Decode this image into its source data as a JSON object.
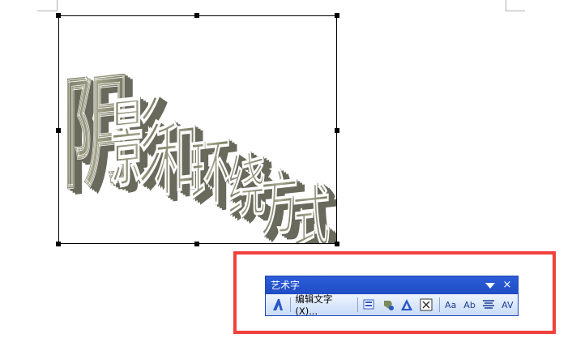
{
  "wordart": {
    "text": "阴影和环绕方式",
    "fill_color": "#8e8f78",
    "shadow_color": "#4f5040"
  },
  "toolbar": {
    "title": "艺术字",
    "edit_text_label": "编辑文字(X)...",
    "close_glyph": "×",
    "buttons": [
      {
        "name": "insert-wordart-icon"
      },
      {
        "name": "wordart-gallery-icon"
      },
      {
        "name": "format-wordart-icon"
      },
      {
        "name": "wordart-shape-icon"
      },
      {
        "name": "text-wrapping-icon"
      },
      {
        "name": "same-letter-heights-icon"
      },
      {
        "name": "vertical-text-icon"
      },
      {
        "name": "alignment-icon"
      },
      {
        "name": "character-spacing-icon"
      }
    ],
    "same_letter_heights_label": "Aa",
    "vertical_text_label": "Ab",
    "char_spacing_label": "AV"
  },
  "colors": {
    "highlight": "#f0403c",
    "toolbar_title": "#2c5ed8",
    "toolbar_body": "#d9e6fb"
  }
}
